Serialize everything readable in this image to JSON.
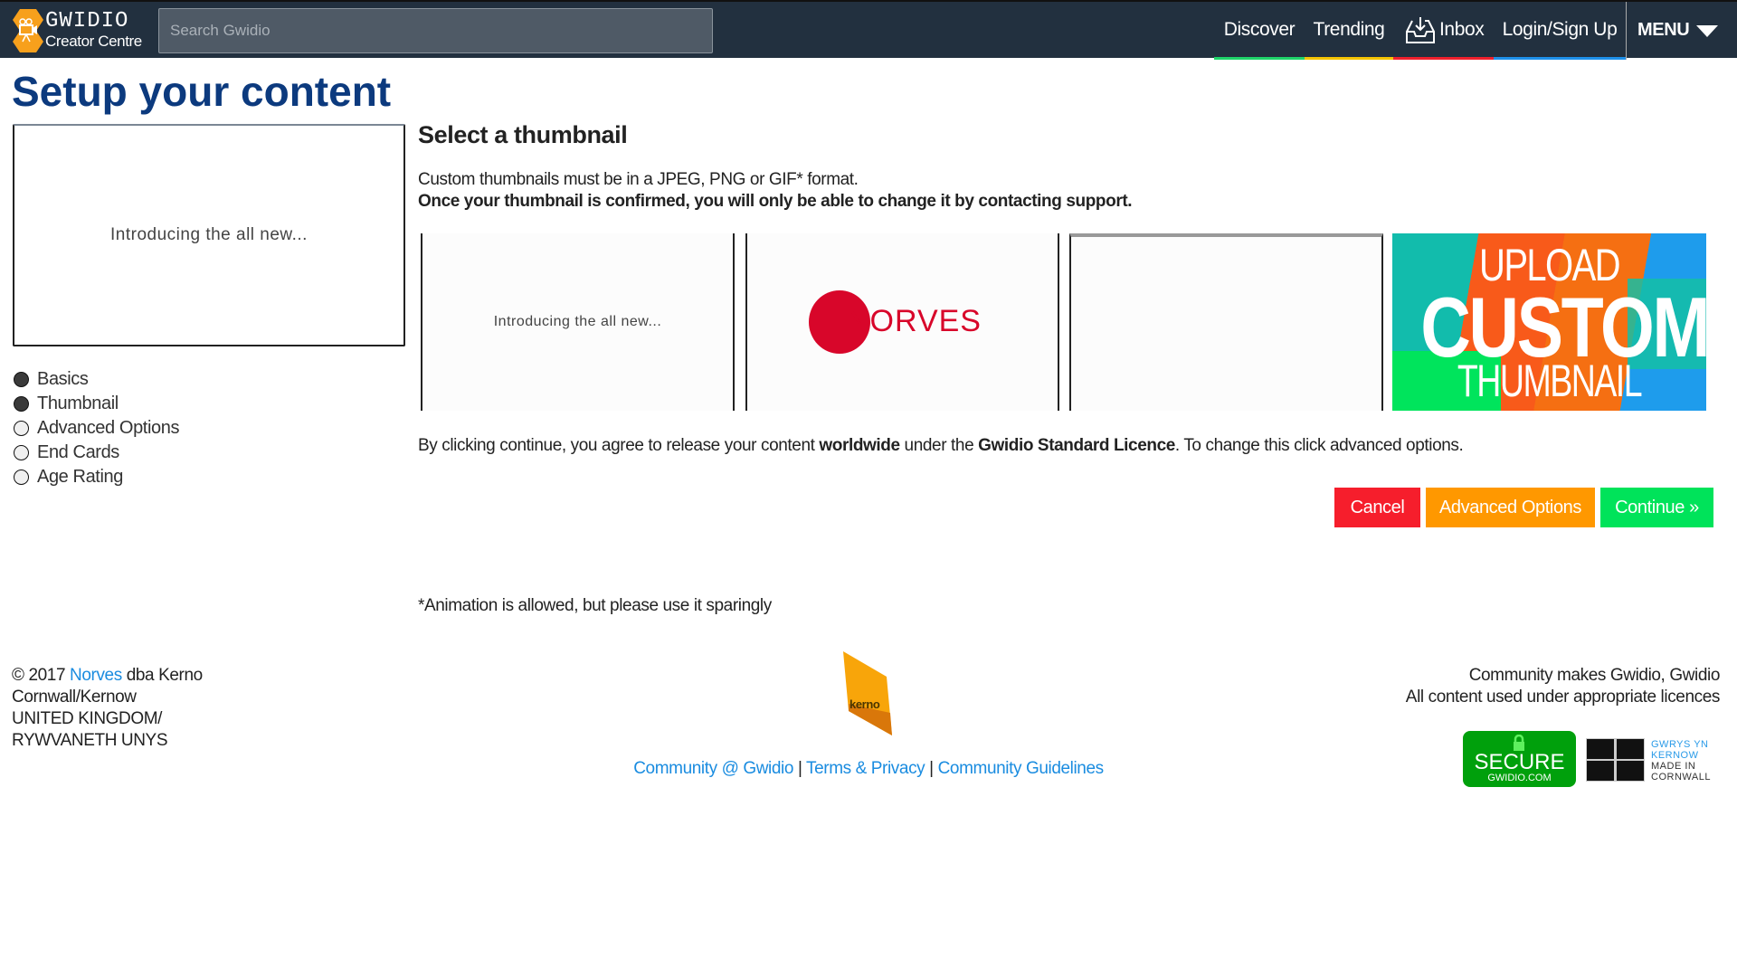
{
  "nav": {
    "brand": "GWIDIO",
    "brand_sub": "Creator Centre",
    "search_placeholder": "Search Gwidio",
    "links": [
      {
        "label": "Discover",
        "color": "#1fd46a"
      },
      {
        "label": "Trending",
        "color": "#f5c400"
      },
      {
        "label": "Inbox",
        "color": "#f0202d",
        "icon": "inbox-icon"
      },
      {
        "label": "Login/Sign Up",
        "color": "#1e90ea"
      }
    ],
    "menu": "MENU"
  },
  "page": {
    "title": "Setup your content",
    "preview_text": "Introducing the all new...",
    "steps": [
      {
        "label": "Basics",
        "done": true
      },
      {
        "label": "Thumbnail",
        "done": true
      },
      {
        "label": "Advanced Options",
        "done": false
      },
      {
        "label": "End Cards",
        "done": false
      },
      {
        "label": "Age Rating",
        "done": false
      }
    ]
  },
  "thumbnail": {
    "heading": "Select a thumbnail",
    "info1": "Custom thumbnails must be in a JPEG, PNG or GIF* format.",
    "info2": "Once your thumbnail is confirmed, you will only be able to change it by contacting support.",
    "options": [
      {
        "text": "Introducing the all new..."
      },
      {
        "text": "NORVES"
      },
      {
        "text": ""
      },
      {
        "line1": "UPLOAD",
        "line2": "CUSTOM",
        "line3": "THUMBNAIL"
      }
    ],
    "agree_1": "By clicking continue, you agree to release your content ",
    "agree_bold1": "worldwide",
    "agree_2": " under the ",
    "agree_bold2": "Gwidio Standard Licence",
    "agree_3": ". To change this click advanced options.",
    "buttons": {
      "cancel": "Cancel",
      "advanced": "Advanced Options",
      "continue": "Continue »"
    },
    "button_colors": {
      "cancel": "#f61e2c",
      "advanced": "#ff9800",
      "continue": "#00e35a"
    },
    "footnote": "*Animation is allowed, but please use it sparingly"
  },
  "footer": {
    "copyright_pre": "© 2017 ",
    "norves": "Norves",
    "copyright_post": " dba Kerno",
    "address": [
      "Cornwall/Kernow",
      "UNITED KINGDOM/",
      "RYWVANETH UNYS"
    ],
    "kerno_logo": "kerno",
    "links": [
      "Community @ Gwidio",
      "Terms & Privacy",
      "Community Guidelines"
    ],
    "separator": "|",
    "right1": "Community makes Gwidio, Gwidio",
    "right2": "All content used under appropriate licences",
    "secure_badge": {
      "line1": "SECURE",
      "line2": "GWIDIO.COM"
    },
    "cornwall_badge": {
      "line1": "GWRYS YN",
      "line2": "KERNOW",
      "line3": "MADE IN",
      "line4": "CORNWALL"
    }
  }
}
